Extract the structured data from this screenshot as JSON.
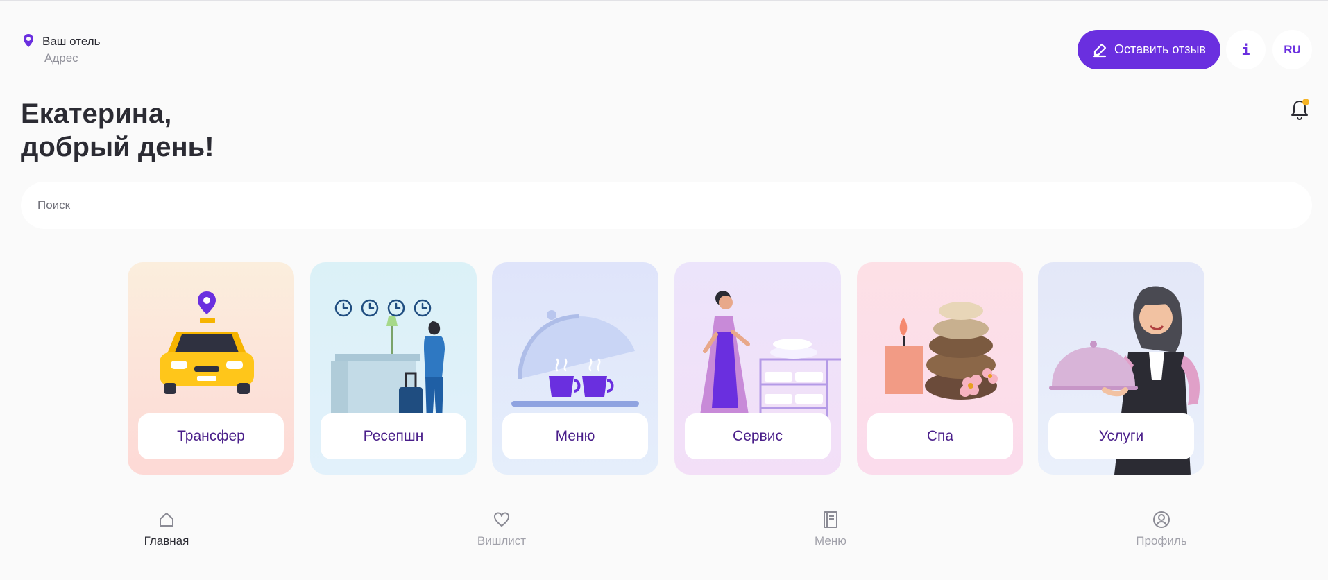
{
  "header": {
    "hotel_name": "Ваш отель",
    "hotel_address": "Адрес",
    "feedback_label": "Оставить отзыв",
    "info_label": "i",
    "lang_label": "RU"
  },
  "greeting": {
    "line1": "Екатерина,",
    "line2": "добрый день!"
  },
  "search": {
    "placeholder": "Поиск"
  },
  "categories": [
    {
      "label": "Трансфер",
      "icon": "taxi-illustration"
    },
    {
      "label": "Ресепшн",
      "icon": "reception-illustration"
    },
    {
      "label": "Меню",
      "icon": "cloche-cups-illustration"
    },
    {
      "label": "Сервис",
      "icon": "housekeeping-illustration"
    },
    {
      "label": "Спа",
      "icon": "spa-stones-illustration"
    },
    {
      "label": "Услуги",
      "icon": "waitress-illustration"
    }
  ],
  "bottom_nav": [
    {
      "label": "Главная",
      "icon": "home-icon",
      "active": true
    },
    {
      "label": "Вишлист",
      "icon": "heart-icon",
      "active": false
    },
    {
      "label": "Меню",
      "icon": "book-icon",
      "active": false
    },
    {
      "label": "Профиль",
      "icon": "user-circle-icon",
      "active": false
    }
  ],
  "colors": {
    "accent": "#6a2fdf",
    "notification_dot": "#f5b324",
    "label_text": "#4a1f8a"
  }
}
